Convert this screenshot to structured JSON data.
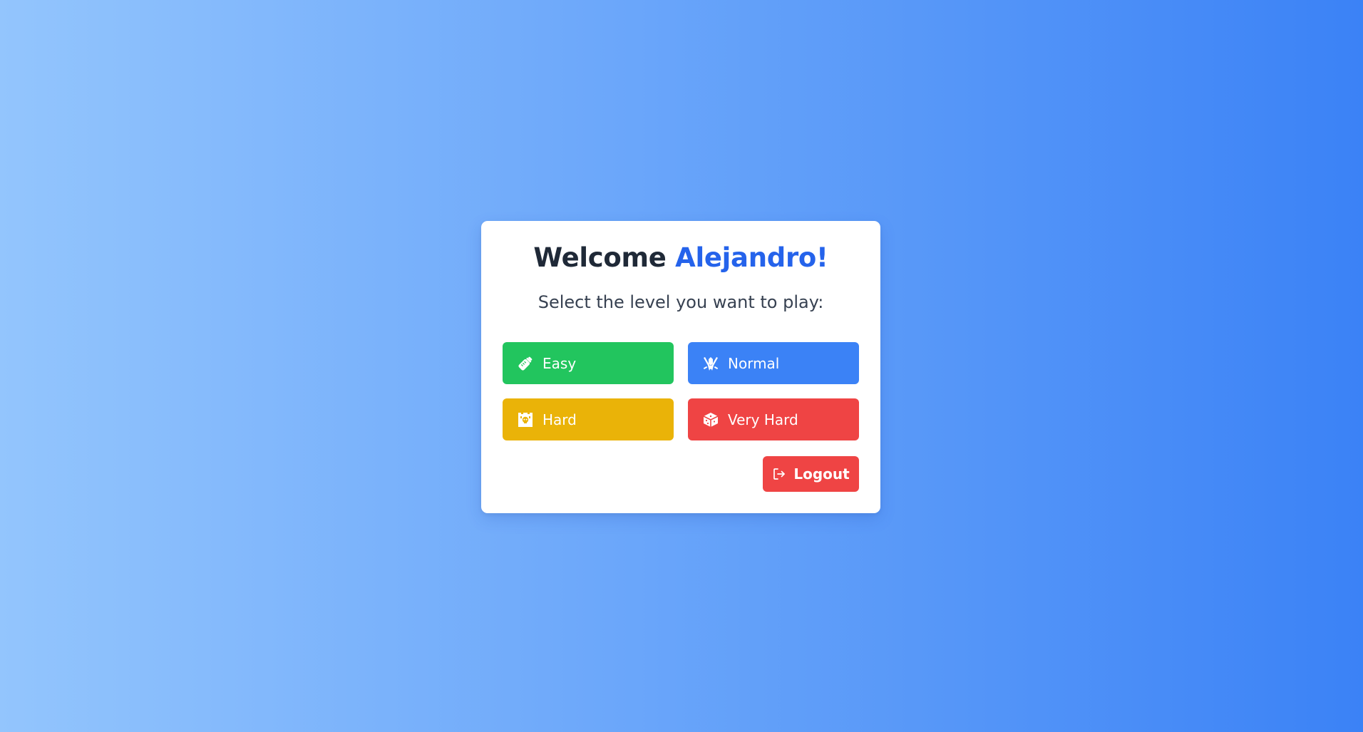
{
  "welcome": {
    "prefix": "Welcome",
    "name": "Alejandro!"
  },
  "prompt": "Select the level you want to play:",
  "levels": [
    {
      "label": "Easy",
      "icon": "baby-bottle-icon",
      "color": "#22c55e"
    },
    {
      "label": "Normal",
      "icon": "crossed-swords-icon",
      "color": "#3b82f6"
    },
    {
      "label": "Hard",
      "icon": "skull-tower-icon",
      "color": "#eab308"
    },
    {
      "label": "Very Hard",
      "icon": "cube-icon",
      "color": "#ef4444"
    }
  ],
  "logout": {
    "label": "Logout",
    "icon": "logout-icon",
    "color": "#ef4444"
  },
  "colors": {
    "background_start": "#93c5fd",
    "background_end": "#3b82f6",
    "accent": "#2563eb"
  }
}
